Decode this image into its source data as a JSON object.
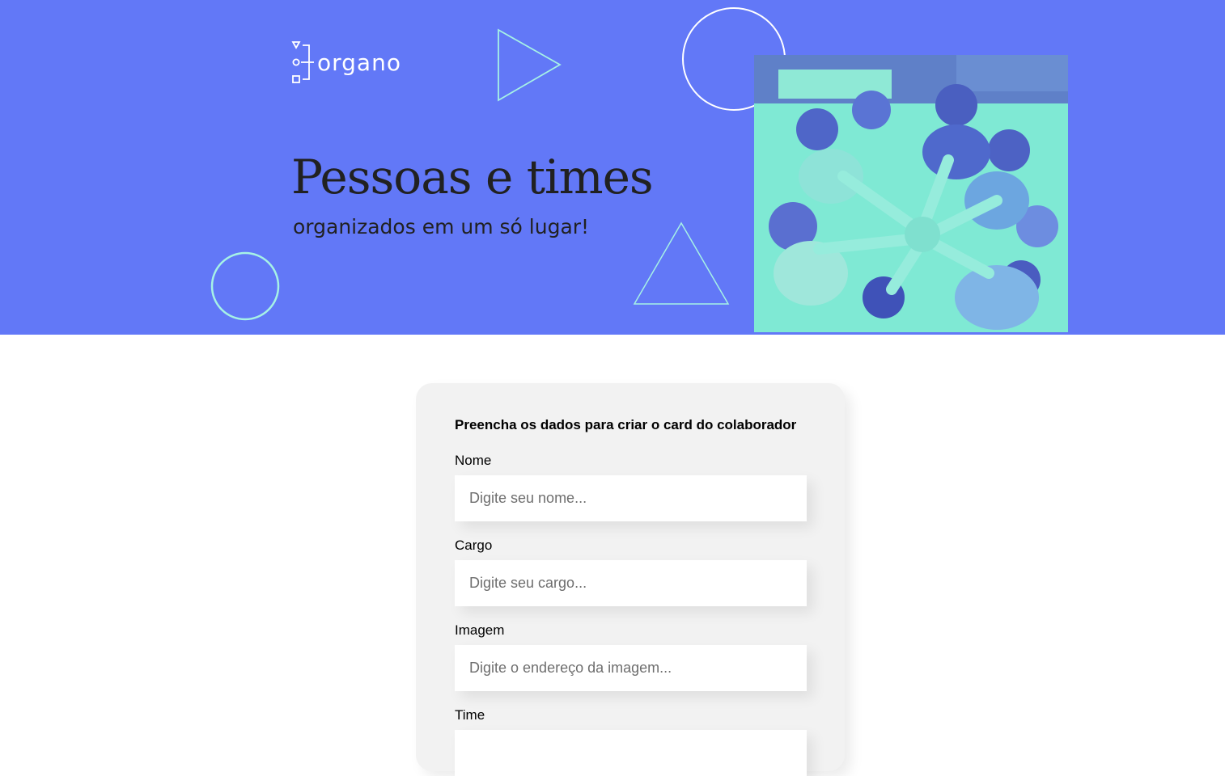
{
  "brand": {
    "logo_text": "organo"
  },
  "hero": {
    "title": "Pessoas e times",
    "subtitle": "organizados em um só lugar!"
  },
  "colors": {
    "banner_background": "#6278f7",
    "accent_shapes": "#a6f2e6",
    "photo_tint": "#7fe9d4"
  },
  "form": {
    "heading": "Preencha os dados para criar o card do colaborador",
    "fields": [
      {
        "label": "Nome",
        "placeholder": "Digite seu nome...",
        "value": ""
      },
      {
        "label": "Cargo",
        "placeholder": "Digite seu cargo...",
        "value": ""
      },
      {
        "label": "Imagem",
        "placeholder": "Digite o endereço da imagem...",
        "value": ""
      },
      {
        "label": "Time",
        "value": ""
      }
    ]
  }
}
